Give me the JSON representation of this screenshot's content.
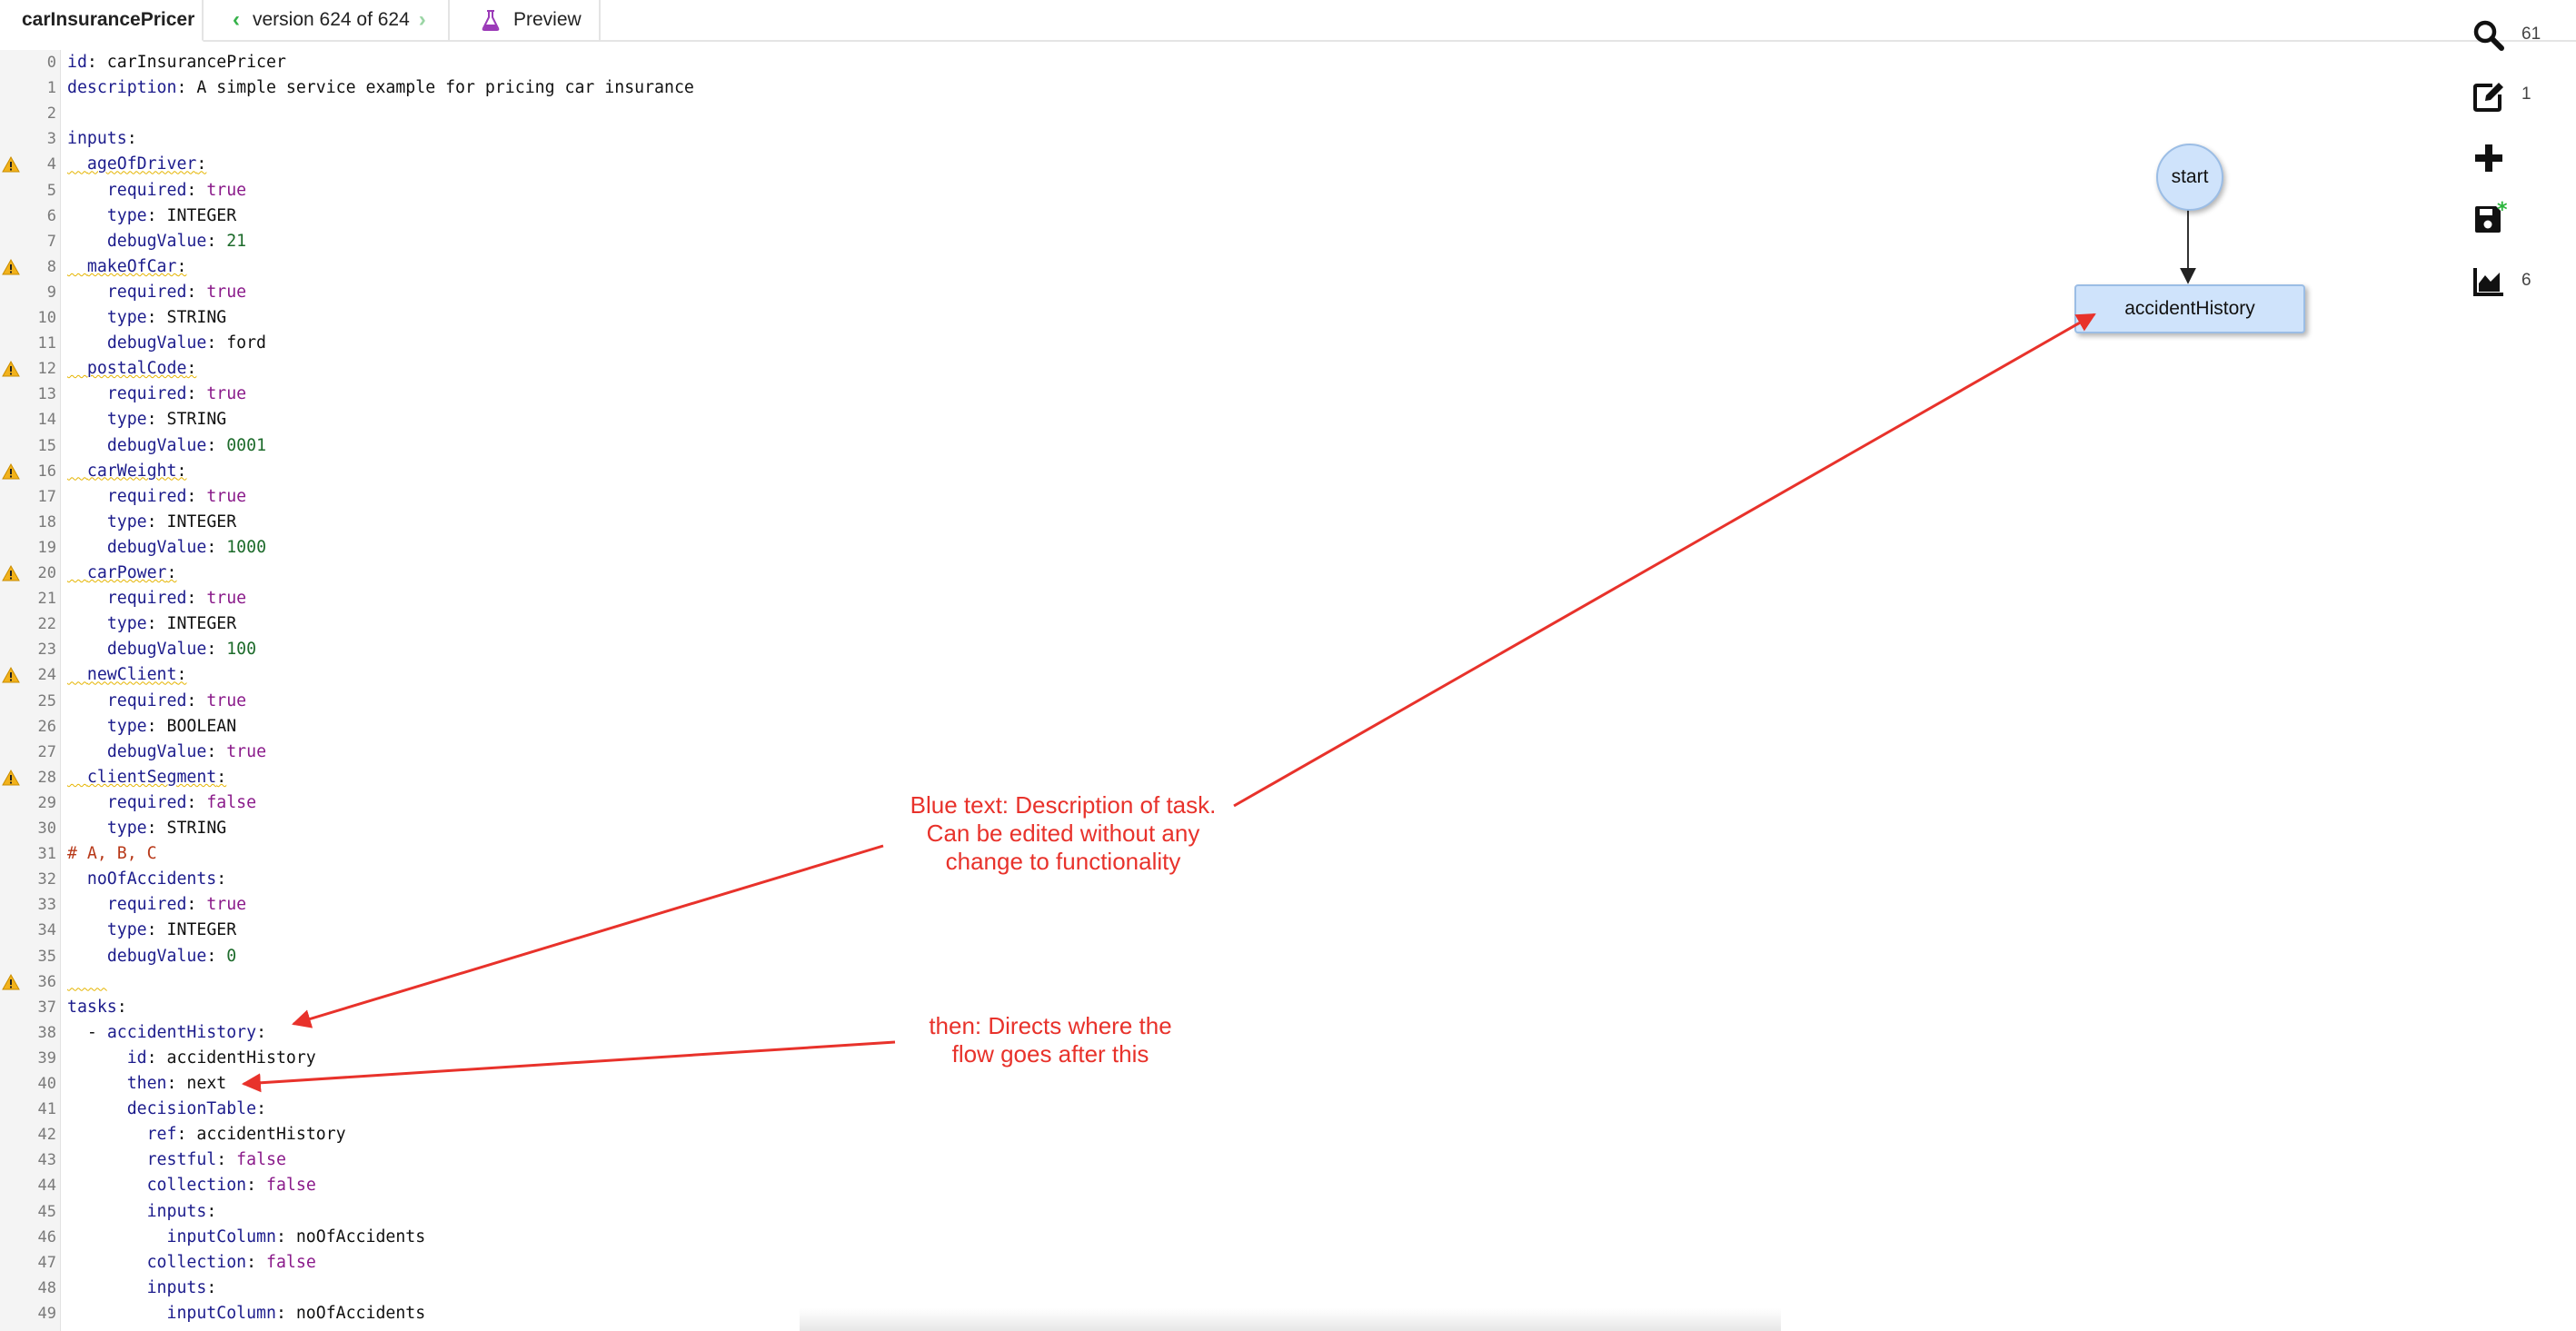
{
  "tabs": {
    "name": "carInsurancePricer",
    "version_label": "version 624 of 624",
    "preview_label": "Preview"
  },
  "editor": {
    "lines": [
      {
        "n": "0",
        "warn": false,
        "segs": [
          {
            "t": "id",
            "c": "k"
          },
          {
            "t": ": carInsurancePricer"
          }
        ]
      },
      {
        "n": "1",
        "warn": false,
        "segs": [
          {
            "t": "description",
            "c": "k"
          },
          {
            "t": ": A simple service example for pricing car insurance"
          }
        ]
      },
      {
        "n": "2",
        "warn": false,
        "segs": []
      },
      {
        "n": "3",
        "warn": false,
        "segs": [
          {
            "t": "inputs",
            "c": "k"
          },
          {
            "t": ":"
          }
        ]
      },
      {
        "n": "4",
        "warn": true,
        "segs": [
          {
            "t": "  ",
            "c": "sq"
          },
          {
            "t": "ageOfDriver",
            "c": "k sq"
          },
          {
            "t": ":",
            "c": "sq"
          }
        ]
      },
      {
        "n": "5",
        "warn": false,
        "segs": [
          {
            "t": "    "
          },
          {
            "t": "required",
            "c": "k"
          },
          {
            "t": ": "
          },
          {
            "t": "true",
            "c": "kw"
          }
        ]
      },
      {
        "n": "6",
        "warn": false,
        "segs": [
          {
            "t": "    "
          },
          {
            "t": "type",
            "c": "k"
          },
          {
            "t": ": INTEGER"
          }
        ]
      },
      {
        "n": "7",
        "warn": false,
        "segs": [
          {
            "t": "    "
          },
          {
            "t": "debugValue",
            "c": "k"
          },
          {
            "t": ": "
          },
          {
            "t": "21",
            "c": "num"
          }
        ]
      },
      {
        "n": "8",
        "warn": true,
        "segs": [
          {
            "t": "  ",
            "c": "sq"
          },
          {
            "t": "makeOfCar",
            "c": "k sq"
          },
          {
            "t": ":",
            "c": "sq"
          }
        ]
      },
      {
        "n": "9",
        "warn": false,
        "segs": [
          {
            "t": "    "
          },
          {
            "t": "required",
            "c": "k"
          },
          {
            "t": ": "
          },
          {
            "t": "true",
            "c": "kw"
          }
        ]
      },
      {
        "n": "10",
        "warn": false,
        "segs": [
          {
            "t": "    "
          },
          {
            "t": "type",
            "c": "k"
          },
          {
            "t": ": STRING"
          }
        ]
      },
      {
        "n": "11",
        "warn": false,
        "segs": [
          {
            "t": "    "
          },
          {
            "t": "debugValue",
            "c": "k"
          },
          {
            "t": ": ford"
          }
        ]
      },
      {
        "n": "12",
        "warn": true,
        "segs": [
          {
            "t": "  ",
            "c": "sq"
          },
          {
            "t": "postalCode",
            "c": "k sq"
          },
          {
            "t": ":",
            "c": "sq"
          }
        ]
      },
      {
        "n": "13",
        "warn": false,
        "segs": [
          {
            "t": "    "
          },
          {
            "t": "required",
            "c": "k"
          },
          {
            "t": ": "
          },
          {
            "t": "true",
            "c": "kw"
          }
        ]
      },
      {
        "n": "14",
        "warn": false,
        "segs": [
          {
            "t": "    "
          },
          {
            "t": "type",
            "c": "k"
          },
          {
            "t": ": STRING"
          }
        ]
      },
      {
        "n": "15",
        "warn": false,
        "segs": [
          {
            "t": "    "
          },
          {
            "t": "debugValue",
            "c": "k"
          },
          {
            "t": ": "
          },
          {
            "t": "0001",
            "c": "num"
          }
        ]
      },
      {
        "n": "16",
        "warn": true,
        "segs": [
          {
            "t": "  ",
            "c": "sq"
          },
          {
            "t": "carWeight",
            "c": "k sq"
          },
          {
            "t": ":",
            "c": "sq"
          }
        ]
      },
      {
        "n": "17",
        "warn": false,
        "segs": [
          {
            "t": "    "
          },
          {
            "t": "required",
            "c": "k"
          },
          {
            "t": ": "
          },
          {
            "t": "true",
            "c": "kw"
          }
        ]
      },
      {
        "n": "18",
        "warn": false,
        "segs": [
          {
            "t": "    "
          },
          {
            "t": "type",
            "c": "k"
          },
          {
            "t": ": INTEGER"
          }
        ]
      },
      {
        "n": "19",
        "warn": false,
        "segs": [
          {
            "t": "    "
          },
          {
            "t": "debugValue",
            "c": "k"
          },
          {
            "t": ": "
          },
          {
            "t": "1000",
            "c": "num"
          }
        ]
      },
      {
        "n": "20",
        "warn": true,
        "segs": [
          {
            "t": "  ",
            "c": "sq"
          },
          {
            "t": "carPower",
            "c": "k sq"
          },
          {
            "t": ":",
            "c": "sq"
          }
        ]
      },
      {
        "n": "21",
        "warn": false,
        "segs": [
          {
            "t": "    "
          },
          {
            "t": "required",
            "c": "k"
          },
          {
            "t": ": "
          },
          {
            "t": "true",
            "c": "kw"
          }
        ]
      },
      {
        "n": "22",
        "warn": false,
        "segs": [
          {
            "t": "    "
          },
          {
            "t": "type",
            "c": "k"
          },
          {
            "t": ": INTEGER"
          }
        ]
      },
      {
        "n": "23",
        "warn": false,
        "segs": [
          {
            "t": "    "
          },
          {
            "t": "debugValue",
            "c": "k"
          },
          {
            "t": ": "
          },
          {
            "t": "100",
            "c": "num"
          }
        ]
      },
      {
        "n": "24",
        "warn": true,
        "segs": [
          {
            "t": "  ",
            "c": "sq"
          },
          {
            "t": "newClient",
            "c": "k sq"
          },
          {
            "t": ":",
            "c": "sq"
          }
        ]
      },
      {
        "n": "25",
        "warn": false,
        "segs": [
          {
            "t": "    "
          },
          {
            "t": "required",
            "c": "k"
          },
          {
            "t": ": "
          },
          {
            "t": "true",
            "c": "kw"
          }
        ]
      },
      {
        "n": "26",
        "warn": false,
        "segs": [
          {
            "t": "    "
          },
          {
            "t": "type",
            "c": "k"
          },
          {
            "t": ": BOOLEAN"
          }
        ]
      },
      {
        "n": "27",
        "warn": false,
        "segs": [
          {
            "t": "    "
          },
          {
            "t": "debugValue",
            "c": "k"
          },
          {
            "t": ": "
          },
          {
            "t": "true",
            "c": "kw"
          }
        ]
      },
      {
        "n": "28",
        "warn": true,
        "segs": [
          {
            "t": "  ",
            "c": "sq"
          },
          {
            "t": "clientSegment",
            "c": "k sq"
          },
          {
            "t": ":",
            "c": "sq"
          }
        ]
      },
      {
        "n": "29",
        "warn": false,
        "segs": [
          {
            "t": "    "
          },
          {
            "t": "required",
            "c": "k"
          },
          {
            "t": ": "
          },
          {
            "t": "false",
            "c": "kw"
          }
        ]
      },
      {
        "n": "30",
        "warn": false,
        "segs": [
          {
            "t": "    "
          },
          {
            "t": "type",
            "c": "k"
          },
          {
            "t": ": STRING"
          }
        ]
      },
      {
        "n": "31",
        "warn": false,
        "segs": [
          {
            "t": "# A, B, C",
            "c": "cmt"
          }
        ]
      },
      {
        "n": "32",
        "warn": false,
        "segs": [
          {
            "t": "  "
          },
          {
            "t": "noOfAccidents",
            "c": "k"
          },
          {
            "t": ":"
          }
        ]
      },
      {
        "n": "33",
        "warn": false,
        "segs": [
          {
            "t": "    "
          },
          {
            "t": "required",
            "c": "k"
          },
          {
            "t": ": "
          },
          {
            "t": "true",
            "c": "kw"
          }
        ]
      },
      {
        "n": "34",
        "warn": false,
        "segs": [
          {
            "t": "    "
          },
          {
            "t": "type",
            "c": "k"
          },
          {
            "t": ": INTEGER"
          }
        ]
      },
      {
        "n": "35",
        "warn": false,
        "segs": [
          {
            "t": "    "
          },
          {
            "t": "debugValue",
            "c": "k"
          },
          {
            "t": ": "
          },
          {
            "t": "0",
            "c": "num"
          }
        ]
      },
      {
        "n": "36",
        "warn": true,
        "segs": [
          {
            "t": "    ",
            "c": "sq"
          }
        ]
      },
      {
        "n": "37",
        "warn": false,
        "segs": [
          {
            "t": "tasks",
            "c": "k"
          },
          {
            "t": ":"
          }
        ]
      },
      {
        "n": "38",
        "warn": false,
        "segs": [
          {
            "t": "  - "
          },
          {
            "t": "accidentHistory",
            "c": "k"
          },
          {
            "t": ":"
          }
        ]
      },
      {
        "n": "39",
        "warn": false,
        "segs": [
          {
            "t": "      "
          },
          {
            "t": "id",
            "c": "k"
          },
          {
            "t": ": accidentHistory"
          }
        ]
      },
      {
        "n": "40",
        "warn": false,
        "segs": [
          {
            "t": "      "
          },
          {
            "t": "then",
            "c": "k"
          },
          {
            "t": ": next"
          }
        ]
      },
      {
        "n": "41",
        "warn": false,
        "segs": [
          {
            "t": "      "
          },
          {
            "t": "decisionTable",
            "c": "k"
          },
          {
            "t": ":"
          }
        ]
      },
      {
        "n": "42",
        "warn": false,
        "segs": [
          {
            "t": "        "
          },
          {
            "t": "ref",
            "c": "k"
          },
          {
            "t": ": accidentHistory"
          }
        ]
      },
      {
        "n": "43",
        "warn": false,
        "segs": [
          {
            "t": "        "
          },
          {
            "t": "restful",
            "c": "k"
          },
          {
            "t": ": "
          },
          {
            "t": "false",
            "c": "kw"
          }
        ]
      },
      {
        "n": "44",
        "warn": false,
        "segs": [
          {
            "t": "        "
          },
          {
            "t": "collection",
            "c": "k"
          },
          {
            "t": ": "
          },
          {
            "t": "false",
            "c": "kw"
          }
        ]
      },
      {
        "n": "45",
        "warn": false,
        "segs": [
          {
            "t": "        "
          },
          {
            "t": "inputs",
            "c": "k"
          },
          {
            "t": ":"
          }
        ]
      },
      {
        "n": "46",
        "warn": false,
        "segs": [
          {
            "t": "          "
          },
          {
            "t": "inputColumn",
            "c": "k"
          },
          {
            "t": ": noOfAccidents"
          }
        ]
      },
      {
        "n": "47",
        "warn": false,
        "segs": [
          {
            "t": "        "
          },
          {
            "t": "collection",
            "c": "k"
          },
          {
            "t": ": "
          },
          {
            "t": "false",
            "c": "kw"
          }
        ]
      },
      {
        "n": "48",
        "warn": false,
        "segs": [
          {
            "t": "        "
          },
          {
            "t": "inputs",
            "c": "k"
          },
          {
            "t": ":"
          }
        ]
      },
      {
        "n": "49",
        "warn": false,
        "segs": [
          {
            "t": "          "
          },
          {
            "t": "inputColumn",
            "c": "k"
          },
          {
            "t": ": noOfAccidents"
          }
        ]
      }
    ]
  },
  "diagram": {
    "start_label": "start",
    "task_label": "accidentHistory"
  },
  "toolbar": {
    "search_count": "61",
    "edit_count": "1",
    "chart_count": "6",
    "icons": [
      "search-icon",
      "edit-icon",
      "add-icon",
      "save-icon",
      "area-chart-icon"
    ]
  },
  "annotations": {
    "note1": [
      "Blue text: Description of task.",
      "Can be edited without any",
      "change to functionality"
    ],
    "note2": [
      "then: Directs where the",
      "flow goes after this"
    ]
  },
  "colors": {
    "annotation": "#e8322b",
    "key": "#1c1c8c",
    "keyword": "#8a1a8a",
    "number": "#1d6b2b",
    "comment": "#b83a1a",
    "node_fill": "#cfe3fb",
    "tab_arrow": "#36b24a"
  }
}
